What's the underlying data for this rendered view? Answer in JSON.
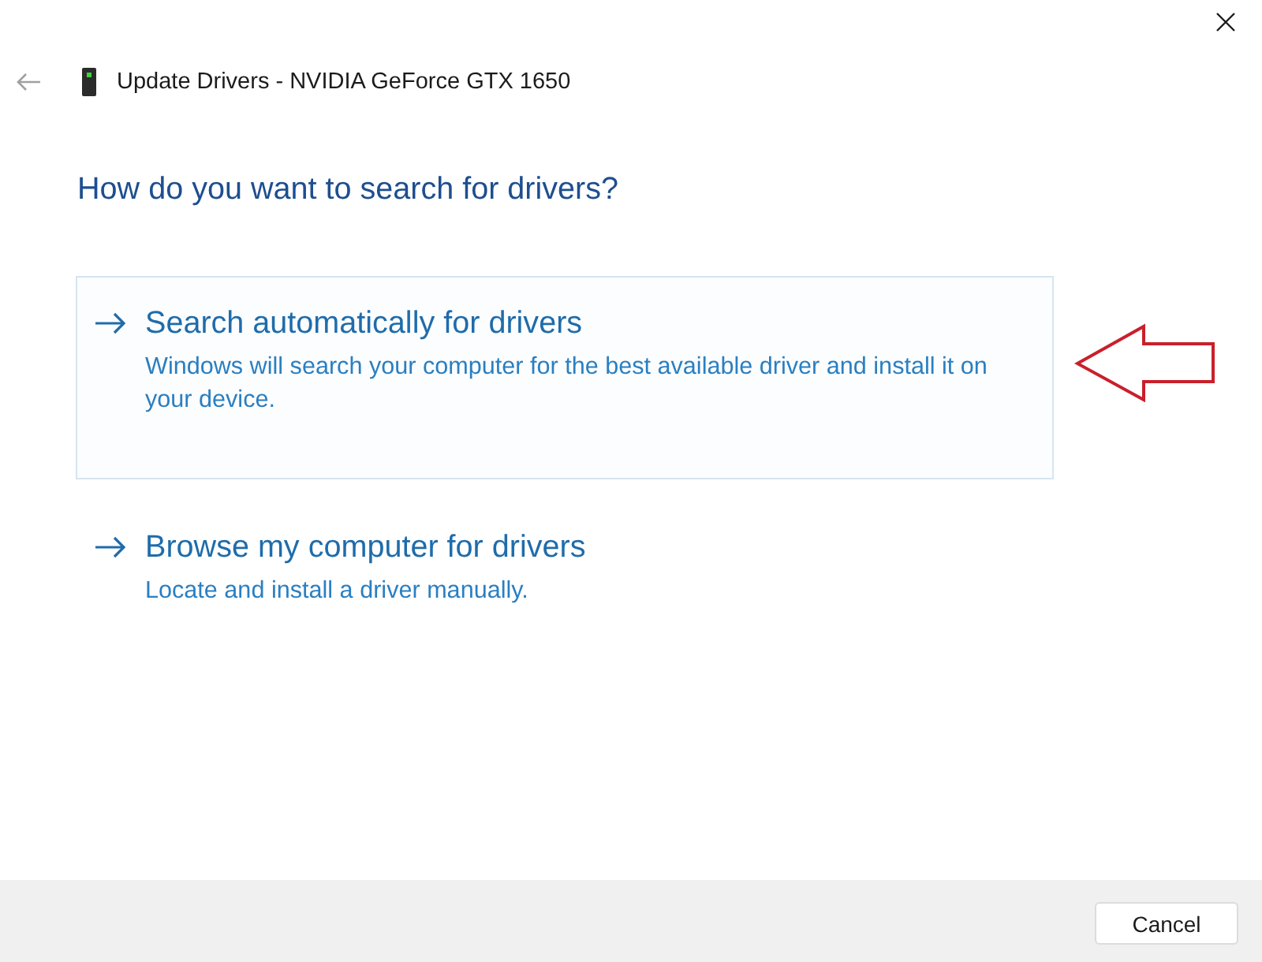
{
  "window": {
    "title": "Update Drivers - NVIDIA GeForce GTX 1650"
  },
  "heading": "How do you want to search for drivers?",
  "options": [
    {
      "title": "Search automatically for drivers",
      "description": "Windows will search your computer for the best available driver and install it on your device.",
      "highlighted": true
    },
    {
      "title": "Browse my computer for drivers",
      "description": "Locate and install a driver manually.",
      "highlighted": false
    }
  ],
  "buttons": [
    {
      "label": "Cancel"
    }
  ]
}
